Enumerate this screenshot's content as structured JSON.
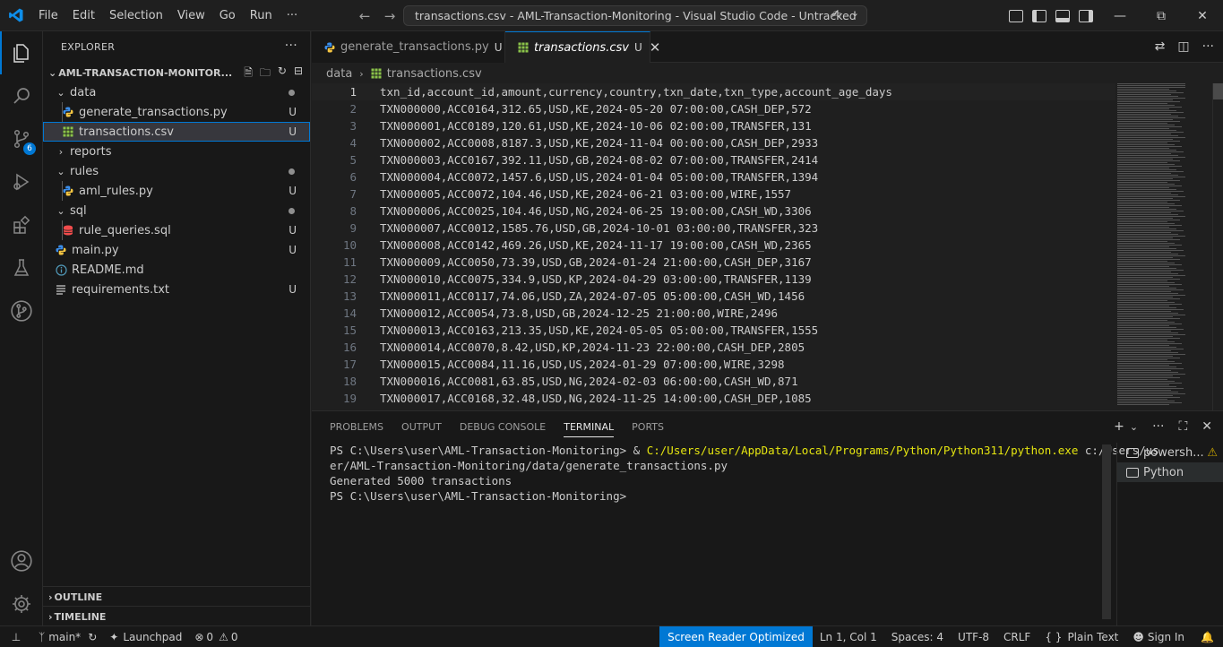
{
  "titlebar": {
    "menu": [
      "File",
      "Edit",
      "Selection",
      "View",
      "Go",
      "Run",
      "···"
    ],
    "search_text": "transactions.csv - AML-Transaction-Monitoring - Visual Studio Code - Untracked"
  },
  "activity": {
    "scm_badge": "6"
  },
  "sidebar": {
    "title": "EXPLORER",
    "workspace": "AML-TRANSACTION-MONITOR...",
    "tree": [
      {
        "label": "data",
        "status": ""
      },
      {
        "label": "generate_transactions.py",
        "status": "U"
      },
      {
        "label": "transactions.csv",
        "status": "U"
      },
      {
        "label": "reports",
        "status": ""
      },
      {
        "label": "rules",
        "status": ""
      },
      {
        "label": "aml_rules.py",
        "status": "U"
      },
      {
        "label": "sql",
        "status": ""
      },
      {
        "label": "rule_queries.sql",
        "status": "U"
      },
      {
        "label": "main.py",
        "status": "U"
      },
      {
        "label": "README.md",
        "status": ""
      },
      {
        "label": "requirements.txt",
        "status": "U"
      }
    ],
    "outline": "OUTLINE",
    "timeline": "TIMELINE"
  },
  "tabs": [
    {
      "label": "generate_transactions.py",
      "status": "U"
    },
    {
      "label": "transactions.csv",
      "status": "U"
    }
  ],
  "breadcrumb": {
    "folder": "data",
    "file": "transactions.csv"
  },
  "code_lines": [
    {
      "n": "1",
      "t": "txn_id,account_id,amount,currency,country,txn_date,txn_type,account_age_days"
    },
    {
      "n": "2",
      "t": "TXN000000,ACC0164,312.65,USD,KE,2024-05-20 07:00:00,CASH_DEP,572"
    },
    {
      "n": "3",
      "t": "TXN000001,ACC0189,120.61,USD,KE,2024-10-06 02:00:00,TRANSFER,131"
    },
    {
      "n": "4",
      "t": "TXN000002,ACC0008,8187.3,USD,KE,2024-11-04 00:00:00,CASH_DEP,2933"
    },
    {
      "n": "5",
      "t": "TXN000003,ACC0167,392.11,USD,GB,2024-08-02 07:00:00,TRANSFER,2414"
    },
    {
      "n": "6",
      "t": "TXN000004,ACC0072,1457.6,USD,US,2024-01-04 05:00:00,TRANSFER,1394"
    },
    {
      "n": "7",
      "t": "TXN000005,ACC0072,104.46,USD,KE,2024-06-21 03:00:00,WIRE,1557"
    },
    {
      "n": "8",
      "t": "TXN000006,ACC0025,104.46,USD,NG,2024-06-25 19:00:00,CASH_WD,3306"
    },
    {
      "n": "9",
      "t": "TXN000007,ACC0012,1585.76,USD,GB,2024-10-01 03:00:00,TRANSFER,323"
    },
    {
      "n": "10",
      "t": "TXN000008,ACC0142,469.26,USD,KE,2024-11-17 19:00:00,CASH_WD,2365"
    },
    {
      "n": "11",
      "t": "TXN000009,ACC0050,73.39,USD,GB,2024-01-24 21:00:00,CASH_DEP,3167"
    },
    {
      "n": "12",
      "t": "TXN000010,ACC0075,334.9,USD,KP,2024-04-29 03:00:00,TRANSFER,1139"
    },
    {
      "n": "13",
      "t": "TXN000011,ACC0117,74.06,USD,ZA,2024-07-05 05:00:00,CASH_WD,1456"
    },
    {
      "n": "14",
      "t": "TXN000012,ACC0054,73.8,USD,GB,2024-12-25 21:00:00,WIRE,2496"
    },
    {
      "n": "15",
      "t": "TXN000013,ACC0163,213.35,USD,KE,2024-05-05 05:00:00,TRANSFER,1555"
    },
    {
      "n": "16",
      "t": "TXN000014,ACC0070,8.42,USD,KP,2024-11-23 22:00:00,CASH_DEP,2805"
    },
    {
      "n": "17",
      "t": "TXN000015,ACC0084,11.16,USD,US,2024-01-29 07:00:00,WIRE,3298"
    },
    {
      "n": "18",
      "t": "TXN000016,ACC0081,63.85,USD,NG,2024-02-03 06:00:00,CASH_WD,871"
    },
    {
      "n": "19",
      "t": "TXN000017,ACC0168,32.48,USD,NG,2024-11-25 14:00:00,CASH_DEP,1085"
    }
  ],
  "panel": {
    "tabs": [
      "PROBLEMS",
      "OUTPUT",
      "DEBUG CONSOLE",
      "TERMINAL",
      "PORTS"
    ],
    "terminal": {
      "l1_prompt": "PS C:\\Users\\user\\AML-Transaction-Monitoring> & ",
      "l1_exe": "C:/Users/user/AppData/Local/Programs/Python/Python311/python.exe",
      "l1_arg": " c:/Users/us",
      "l2": "er/AML-Transaction-Monitoring/data/generate_transactions.py",
      "l3": "Generated 5000 transactions",
      "l4": "PS C:\\Users\\user\\AML-Transaction-Monitoring>"
    },
    "terminals": [
      "powersh...",
      "Python"
    ]
  },
  "statusbar": {
    "branch": "main*",
    "launchpad": "Launchpad",
    "errors": "0",
    "warnings": "0",
    "sro": "Screen Reader Optimized",
    "position": "Ln 1, Col 1",
    "spaces": "Spaces: 4",
    "encoding": "UTF-8",
    "eol": "CRLF",
    "language": "Plain Text",
    "signin": "Sign In"
  },
  "colors": {
    "accent": "#0078d4",
    "terminal_path": "#e5e510",
    "python_icon": "#3b8eea",
    "csv_icon": "#8bc34a",
    "sql_icon": "#f14c4c"
  }
}
